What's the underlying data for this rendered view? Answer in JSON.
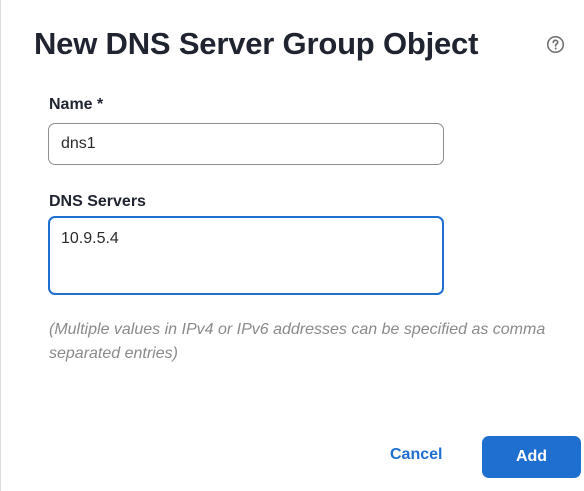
{
  "dialog": {
    "title": "New DNS Server Group Object",
    "help_icon": "help-circle-icon"
  },
  "form": {
    "name_label": "Name *",
    "name_value": "dns1",
    "dns_label": "DNS Servers",
    "dns_value": "10.9.5.4",
    "hint": "(Multiple values in IPv4 or IPv6 addresses can be specified as comma separated entries)"
  },
  "actions": {
    "cancel_label": "Cancel",
    "add_label": "Add"
  },
  "colors": {
    "accent": "#1f6fd1",
    "title_text": "#1f2430",
    "hint_text": "#8a8a8a"
  }
}
